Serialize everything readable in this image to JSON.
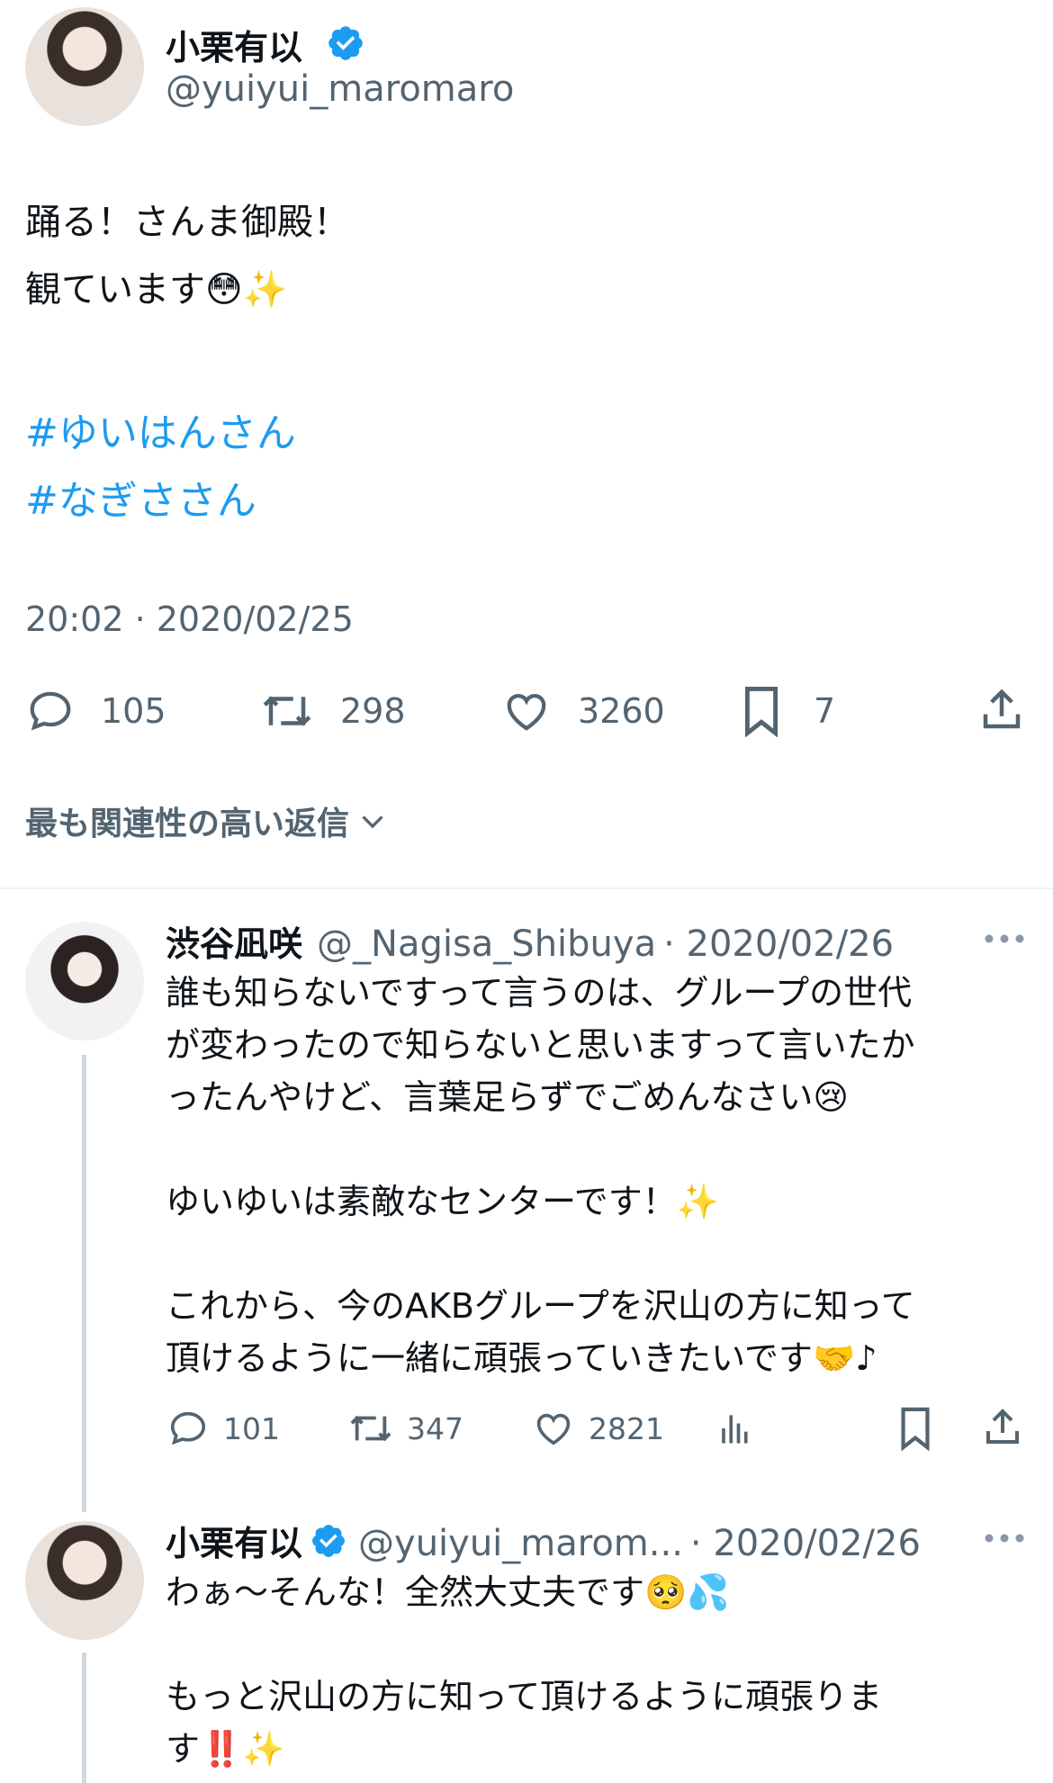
{
  "main_tweet": {
    "author_name": "小栗有以",
    "author_handle": "@yuiyui_maromaro",
    "body_line1": "踊る！さんま御殿！",
    "body_line2": "観ています😳✨",
    "hashtags": [
      "#ゆいはんさん",
      "#なぎささん"
    ],
    "timestamp": "20:02 · 2020/02/25",
    "stats": {
      "replies": "105",
      "retweets": "298",
      "likes": "3260",
      "bookmarks": "7"
    }
  },
  "sort_label": "最も関連性の高い返信",
  "replies": [
    {
      "author_name": "渋谷凪咲",
      "author_handle": "@_Nagisa_Shibuya",
      "date": "· 2020/02/26",
      "lines": [
        "誰も知らないですって言うのは、グループの世代",
        "が変わったので知らないと思いますって言いたか",
        "ったんやけど、言葉足らずでごめんなさい😢",
        "",
        "ゆいゆいは素敵なセンターです！✨",
        "",
        "これから、今のAKBグループを沢山の方に知って",
        "頂けるように一緒に頑張っていきたいです🤝♪"
      ],
      "stats": {
        "replies": "101",
        "retweets": "347",
        "likes": "2821"
      }
    },
    {
      "author_name": "小栗有以",
      "author_handle": "@yuiyui_marom...",
      "date": "· 2020/02/26",
      "lines": [
        "わぁ〜そんな！全然大丈夫です🥺💦",
        "",
        "もっと沢山の方に知って頂けるように頑張りま",
        "す‼️✨"
      ]
    }
  ],
  "colors": {
    "text": "#0f1419",
    "secondary": "#536471",
    "accent": "#1d9bf0",
    "verified": "#1d9bf0",
    "divider": "#eff3f4"
  },
  "icons": [
    "verified-badge-icon",
    "reply-icon",
    "retweet-icon",
    "like-icon",
    "bookmark-icon",
    "share-icon",
    "chevron-down-icon",
    "more-icon",
    "views-icon"
  ]
}
